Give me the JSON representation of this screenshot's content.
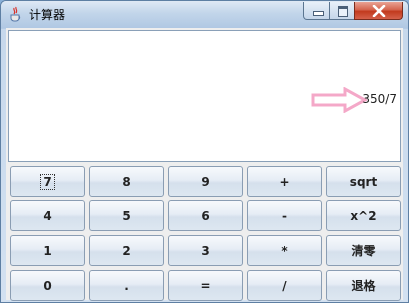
{
  "window": {
    "title": "计算器",
    "icon": "java-cup-icon",
    "controls": [
      "minimize-icon",
      "maximize-icon",
      "close-icon"
    ]
  },
  "display": {
    "value": "350/7",
    "annotation_arrow_color": "#f4a8c8"
  },
  "keypad": {
    "rows": [
      [
        "7",
        "8",
        "9",
        "+",
        "sqrt"
      ],
      [
        "4",
        "5",
        "6",
        "-",
        "x^2"
      ],
      [
        "1",
        "2",
        "3",
        "*",
        "清零"
      ],
      [
        "0",
        ".",
        "=",
        "/",
        "退格"
      ]
    ],
    "focused_key": "7"
  }
}
